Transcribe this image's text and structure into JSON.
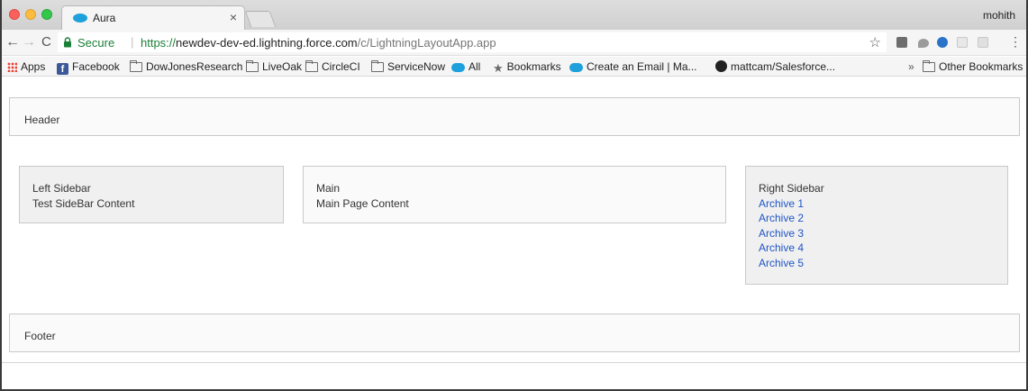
{
  "browser": {
    "tab": {
      "title": "Aura",
      "close_glyph": "×"
    },
    "user": "mohith",
    "nav": {
      "back_glyph": "←",
      "forward_glyph": "→",
      "reload_glyph": "C"
    },
    "url": {
      "secure_label": "Secure",
      "separator": "|",
      "scheme": "https://",
      "host": "newdev-dev-ed.lightning.force.com",
      "path": "/c/LightningLayoutApp.app"
    },
    "star_glyph": "☆",
    "menu_glyph": "⋮",
    "bookmarks": [
      {
        "label": "Apps",
        "icon": "apps-grid-icon"
      },
      {
        "label": "Facebook",
        "icon": "facebook-icon"
      },
      {
        "label": "DowJonesResearch",
        "icon": "folder-icon"
      },
      {
        "label": "LiveOak",
        "icon": "folder-icon"
      },
      {
        "label": "CircleCI",
        "icon": "folder-icon"
      },
      {
        "label": "ServiceNow",
        "icon": "folder-icon"
      },
      {
        "label": "All",
        "icon": "salesforce-cloud-icon"
      },
      {
        "label": "Bookmarks",
        "icon": "star-icon"
      },
      {
        "label": "Create an Email | Ma...",
        "icon": "salesforce-cloud-icon"
      },
      {
        "label": "mattcam/Salesforce...",
        "icon": "github-icon"
      }
    ],
    "overflow_glyph": "»",
    "other_bookmarks": "Other Bookmarks"
  },
  "page": {
    "header": "Header",
    "left_sidebar": {
      "title": "Left Sidebar",
      "content": "Test SideBar Content"
    },
    "main": {
      "title": "Main",
      "content": "Main Page Content"
    },
    "right_sidebar": {
      "title": "Right Sidebar",
      "links": [
        "Archive 1",
        "Archive 2",
        "Archive 3",
        "Archive 4",
        "Archive 5"
      ]
    },
    "footer": "Footer"
  },
  "colors": {
    "link": "#1f55c7",
    "secure_green": "#1a7f37",
    "sidebar_bg": "#f0f0f0",
    "box_border": "#c9c9c9"
  }
}
